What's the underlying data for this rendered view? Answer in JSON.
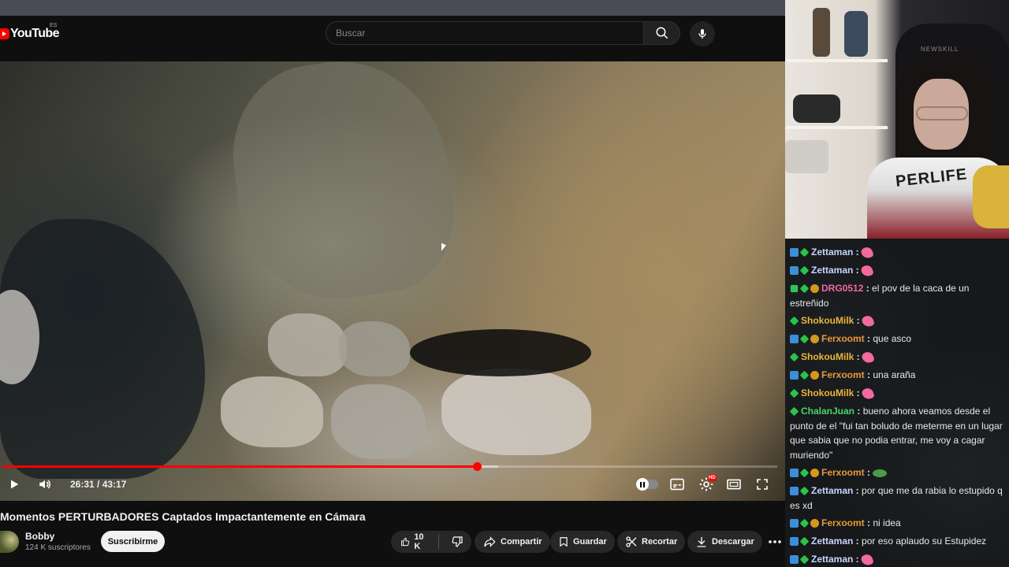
{
  "masthead": {
    "logo_text": "YouTube",
    "country_code": "ES",
    "search_placeholder": "Buscar",
    "search_icon": "search-icon",
    "mic_icon": "mic-icon"
  },
  "player": {
    "current_time": "26:31",
    "duration": "43:17",
    "time_display": "26:31 / 43:17",
    "played_fraction": 0.6125,
    "buffered_fraction": 0.64,
    "accent_color": "#ff0000",
    "settings_badge": "HD"
  },
  "video": {
    "title": "Momentos PERTURBADORES Captados Impactantemente en Cámara",
    "channel_name": "Bobby",
    "subscribers": "124 K suscriptores",
    "subscribe_label": "Suscribirme",
    "like_count": "10 K",
    "share_label": "Compartir",
    "save_label": "Guardar",
    "clip_label": "Recortar",
    "download_label": "Descargar"
  },
  "webcam": {
    "hoodie_text": "PERLIFE",
    "chair_brand": "NEWSKILL"
  },
  "chat": {
    "messages": [
      {
        "user": "Zettaman",
        "color": "#c8d6ff",
        "badges": [
          "broadcaster-icon",
          "sub-icon"
        ],
        "text": "",
        "emote": "pink-emote"
      },
      {
        "user": "Zettaman",
        "color": "#c8d6ff",
        "badges": [
          "broadcaster-icon",
          "sub-icon"
        ],
        "text": "",
        "emote": "pink-emote"
      },
      {
        "user": "DRG0512",
        "color": "#f06aa0",
        "badges": [
          "mod-icon",
          "sub-icon",
          "gold-icon"
        ],
        "text": "el pov de la caca de un estreñido",
        "emote": ""
      },
      {
        "user": "ShokouMilk",
        "color": "#e8b53a",
        "badges": [
          "sub-icon"
        ],
        "text": "",
        "emote": "pink-emote"
      },
      {
        "user": "Ferxoomt",
        "color": "#e89a3a",
        "badges": [
          "broadcaster-icon",
          "sub-icon",
          "gold-icon"
        ],
        "text": "que asco",
        "emote": ""
      },
      {
        "user": "ShokouMilk",
        "color": "#e8b53a",
        "badges": [
          "sub-icon"
        ],
        "text": "",
        "emote": "pink-emote"
      },
      {
        "user": "Ferxoomt",
        "color": "#e89a3a",
        "badges": [
          "broadcaster-icon",
          "sub-icon",
          "gold-icon"
        ],
        "text": "una araña",
        "emote": ""
      },
      {
        "user": "ShokouMilk",
        "color": "#e8b53a",
        "badges": [
          "sub-icon"
        ],
        "text": "",
        "emote": "pink-emote"
      },
      {
        "user": "ChalanJuan",
        "color": "#47d66b",
        "badges": [
          "sub-icon"
        ],
        "text": "bueno ahora veamos desde el punto de el \"fui tan boludo de meterme en un lugar que sabia que no podia entrar, me voy a cagar muriendo\"",
        "emote": ""
      },
      {
        "user": "Ferxoomt",
        "color": "#e89a3a",
        "badges": [
          "broadcaster-icon",
          "sub-icon",
          "gold-icon"
        ],
        "text": "",
        "emote": "frog-emote"
      },
      {
        "user": "Zettaman",
        "color": "#c8d6ff",
        "badges": [
          "broadcaster-icon",
          "sub-icon"
        ],
        "text": "por que me da rabia lo estupido q es xd",
        "emote": ""
      },
      {
        "user": "Ferxoomt",
        "color": "#e89a3a",
        "badges": [
          "broadcaster-icon",
          "sub-icon",
          "gold-icon"
        ],
        "text": "ni idea",
        "emote": ""
      },
      {
        "user": "Zettaman",
        "color": "#c8d6ff",
        "badges": [
          "broadcaster-icon",
          "sub-icon"
        ],
        "text": "por eso aplaudo su Estupidez",
        "emote": ""
      },
      {
        "user": "Zettaman",
        "color": "#c8d6ff",
        "badges": [
          "broadcaster-icon",
          "sub-icon"
        ],
        "text": "",
        "emote": "pink-emote"
      }
    ]
  }
}
